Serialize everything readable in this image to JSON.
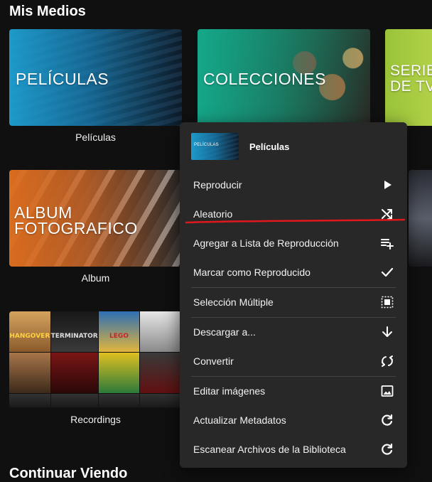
{
  "section_media_title": "Mis Medios",
  "section_continue_title": "Continuar Viendo",
  "tiles": {
    "peliculas": {
      "image_text": "PELÍCULAS",
      "caption": "Películas"
    },
    "colecciones": {
      "image_text": "COLECCIONES"
    },
    "series": {
      "image_text": "SERIE\nDE TV"
    },
    "album": {
      "image_text": "ALBUM\nFOTOGRAFICO",
      "caption": "Album"
    },
    "recordings": {
      "caption": "Recordings",
      "poster_texts": [
        "HANGOVER",
        "TERMINATOR",
        "LEGO",
        ""
      ]
    }
  },
  "context_menu": {
    "thumb_text": "PELÍCULAS",
    "title": "Películas",
    "items": [
      {
        "label": "Reproducir",
        "icon": "play-icon"
      },
      {
        "label": "Aleatorio",
        "icon": "shuffle-icon"
      },
      {
        "label": "Agregar a Lista de Reproducción",
        "icon": "playlist-add-icon"
      },
      {
        "label": "Marcar como Reproducido",
        "icon": "check-icon"
      },
      {
        "label": "Selección Múltiple",
        "icon": "select-multiple-icon"
      },
      {
        "label": "Descargar a...",
        "icon": "download-arrow-icon"
      },
      {
        "label": "Convertir",
        "icon": "convert-icon"
      },
      {
        "label": "Editar imágenes",
        "icon": "image-icon"
      },
      {
        "label": "Actualizar Metadatos",
        "icon": "refresh-icon"
      },
      {
        "label": "Escanear Archivos de la Biblioteca",
        "icon": "refresh-icon"
      }
    ]
  },
  "colors": {
    "background": "#101010",
    "menu_background": "#282828",
    "annotation_underline": "#e0181c"
  }
}
